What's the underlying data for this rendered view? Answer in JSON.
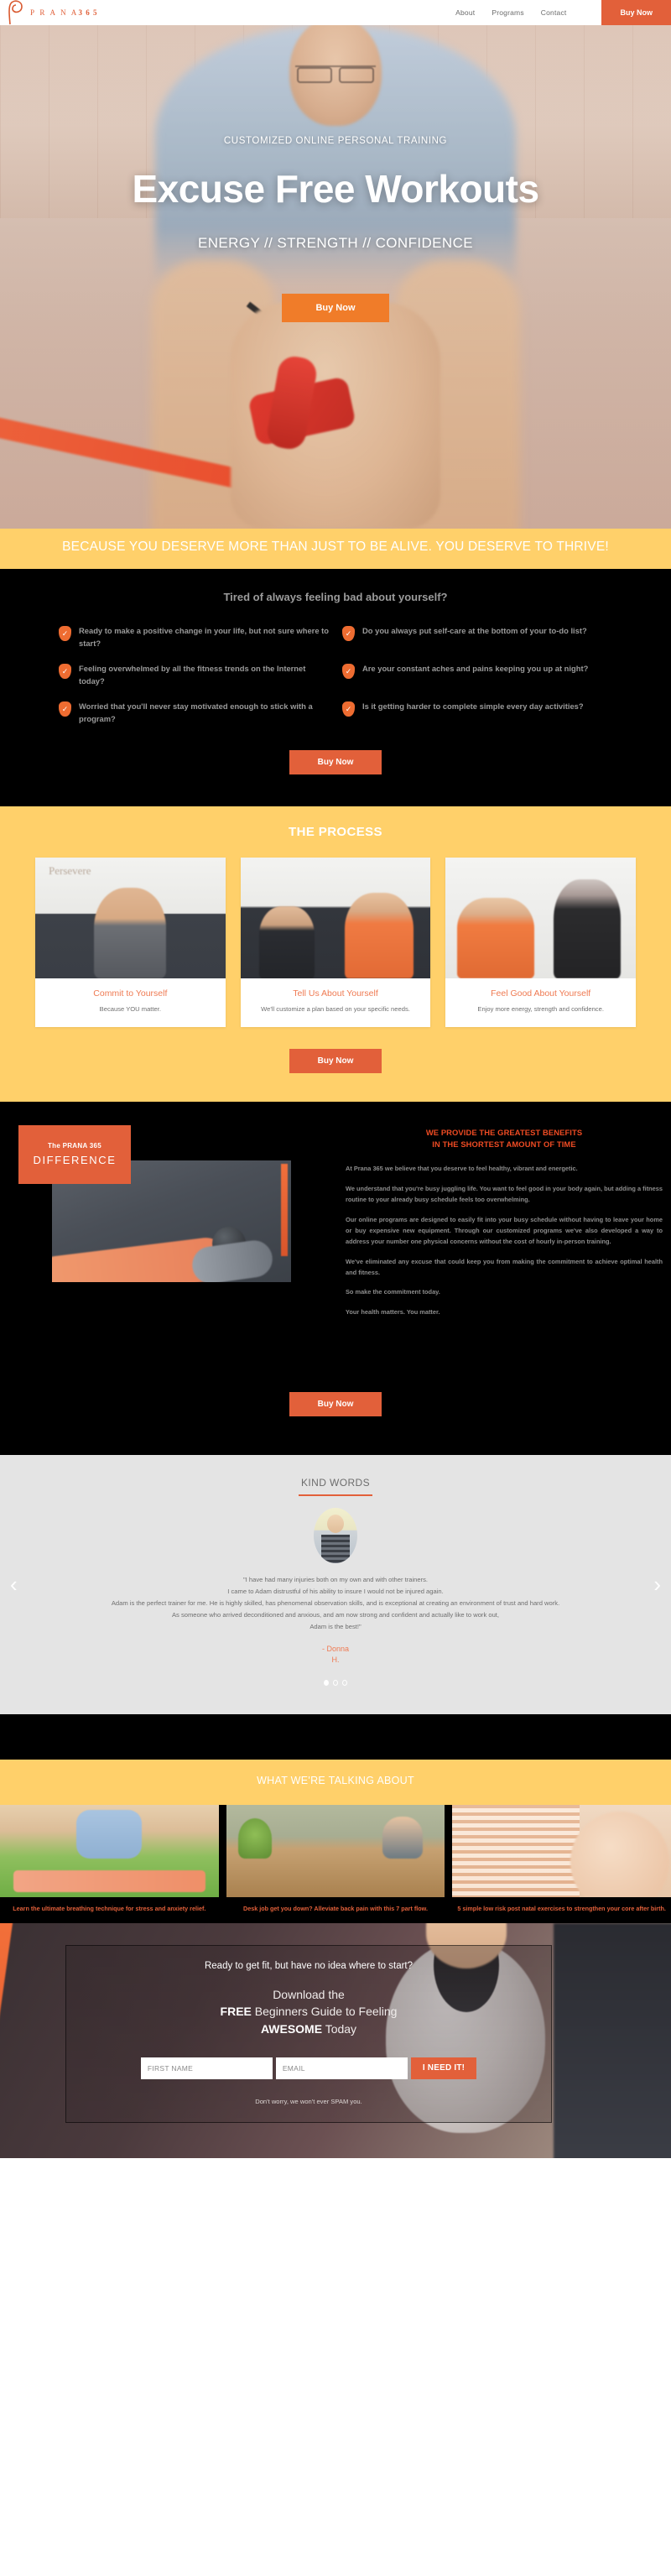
{
  "header": {
    "brand_prana": "P R A N A",
    "brand_365": "3 6 5",
    "nav": [
      {
        "label": "About"
      },
      {
        "label": "Programs"
      },
      {
        "label": "Contact"
      }
    ],
    "buy_now": "Buy Now"
  },
  "hero": {
    "eyebrow": "CUSTOMIZED ONLINE PERSONAL TRAINING",
    "title": "Excuse Free Workouts",
    "subtitle": "ENERGY // STRENGTH // CONFIDENCE",
    "buy_now": "Buy Now"
  },
  "banner": {
    "text": "BECAUSE YOU DESERVE MORE THAN JUST TO BE ALIVE. YOU DESERVE TO THRIVE!"
  },
  "checklist": {
    "heading": "Tired of always feeling bad about yourself?",
    "items": [
      "Ready to make a positive change in your life, but not sure where to start?",
      "Do you always put self-care at the bottom of your to-do list?",
      "Feeling overwhelmed by all the fitness trends on the Internet today?",
      "Are your constant aches and pains keeping you up at night?",
      "Worried that you'll never stay motivated enough to stick with a program?",
      "Is it getting harder to complete simple every day activities?"
    ],
    "buy_now": "Buy Now"
  },
  "process": {
    "heading": "THE PROCESS",
    "cards": [
      {
        "title": "Commit to Yourself",
        "desc": "Because YOU matter."
      },
      {
        "title": "Tell Us About Yourself",
        "desc": "We'll customize a plan based on your specific needs."
      },
      {
        "title": "Feel Good About Yourself",
        "desc": "Enjoy more energy, strength and confidence."
      }
    ],
    "buy_now": "Buy Now"
  },
  "difference": {
    "badge_small": "The PRANA 365",
    "badge_large": "DIFFERENCE",
    "heading_line1": "WE PROVIDE THE GREATEST BENEFITS",
    "heading_line2": "IN THE SHORTEST AMOUNT OF TIME",
    "paragraphs": [
      "At Prana 365 we believe that you deserve to feel healthy, vibrant and energetic.",
      "We understand that you're busy juggling life.  You want to feel good in your body again, but adding a fitness routine to your already busy schedule feels too overwhelming.",
      "Our online programs are designed to easily fit into your busy schedule without having to leave your home or buy  expensive new equipment.  Through our customized programs we've also developed a way to address your number one physical concerns without the cost of hourly in-person training.",
      "We've eliminated any excuse that could keep you from making the commitment to achieve optimal health and fitness.",
      "So make the commitment today.",
      "Your health matters.  You matter."
    ],
    "buy_now": "Buy Now"
  },
  "testimonial": {
    "heading": "KIND WORDS",
    "quote": "\"I have had many injuries both on my own and with other trainers.\nI came to Adam distrustful of his ability to insure I would not be injured again.\nAdam is the perfect trainer for me. He is highly skilled, has phenomenal observation skills, and is exceptional at creating an environment of trust and hard work.\nAs someone who arrived deconditioned and anxious, and am now strong and confident and actually like to work out,\nAdam is the best!\"",
    "author": "- Donna\nH.",
    "prev_arrow": "‹",
    "next_arrow": "›",
    "dots": 3,
    "active_dot": 0
  },
  "blog": {
    "heading": "WHAT WE'RE TALKING ABOUT",
    "posts": [
      {
        "caption": "Learn the ultimate breathing technique for stress and anxiety relief."
      },
      {
        "caption": "Desk job get you down? Alleviate back pain with this 7 part flow."
      },
      {
        "caption": "5 simple low risk post natal exercises to strengthen your core after birth."
      }
    ]
  },
  "cta": {
    "question": "Ready to get fit, but have no idea where to start?",
    "download_line1": "Download the",
    "download_free": "FREE",
    "download_line2": " Beginners Guide to Feeling",
    "download_awesome": "AWESOME",
    "download_line3": " Today",
    "first_name_placeholder": "FIRST NAME",
    "email_placeholder": "EMAIL",
    "submit_label": "I NEED IT!",
    "note": "Don't worry, we won't ever SPAM you."
  },
  "colors": {
    "orange": "#e2603a",
    "orange_bright": "#f07c29",
    "yellow": "#ffd06a",
    "black": "#000000",
    "grey_bg": "#e4e4e4"
  }
}
